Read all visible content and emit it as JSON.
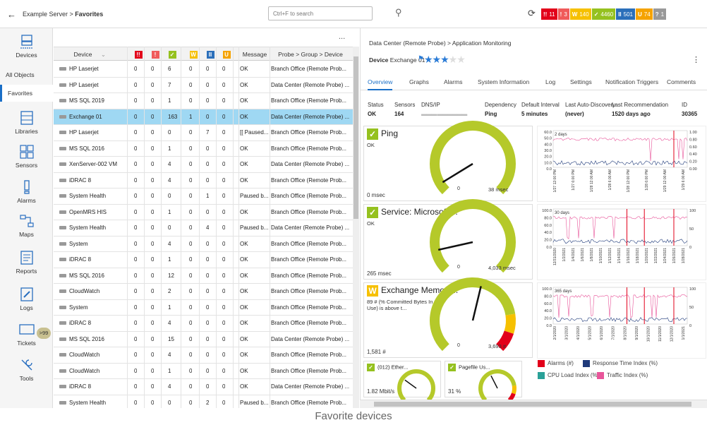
{
  "topbar": {
    "breadcrumb_prefix": "Example Server >",
    "breadcrumb_current": "Favorites",
    "search_placeholder": "Ctrl+F to search",
    "badges": [
      {
        "icon": "!!",
        "count": "11",
        "color": "#e2001a"
      },
      {
        "icon": "!",
        "count": "3",
        "color": "#f05a5a"
      },
      {
        "icon": "W",
        "count": "140",
        "color": "#f6c000"
      },
      {
        "icon": "✓",
        "count": "4460",
        "color": "#95c11f"
      },
      {
        "icon": "II",
        "count": "501",
        "color": "#2b6fba"
      },
      {
        "icon": "U",
        "count": "74",
        "color": "#f5a300"
      },
      {
        "icon": "?",
        "count": "1",
        "color": "#999999"
      }
    ]
  },
  "sidebar": {
    "items": [
      {
        "label": "Devices"
      },
      {
        "label": "All Objects"
      },
      {
        "label": "Favorites"
      },
      {
        "label": "Libraries"
      },
      {
        "label": "Sensors"
      },
      {
        "label": "Alarms"
      },
      {
        "label": "Maps"
      },
      {
        "label": "Reports"
      },
      {
        "label": "Logs"
      },
      {
        "label": "Tickets",
        "badge": ">99"
      },
      {
        "label": "Tools"
      }
    ]
  },
  "table": {
    "more_label": "...",
    "headers": {
      "device": "Device",
      "message": "Message",
      "path": "Probe > Group > Device",
      "status_icons": [
        "!!",
        "!",
        "✓",
        "W",
        "II",
        "U"
      ]
    },
    "rows": [
      {
        "device": "HP Laserjet",
        "c": [
          "0",
          "0",
          "6",
          "0",
          "0",
          "0"
        ],
        "message": "OK",
        "path": "Branch Office (Remote Prob..."
      },
      {
        "device": "HP Laserjet",
        "c": [
          "0",
          "0",
          "7",
          "0",
          "0",
          "0"
        ],
        "message": "OK",
        "path": "Data Center (Remote Probe) ..."
      },
      {
        "device": "MS SQL 2019",
        "c": [
          "0",
          "0",
          "1",
          "0",
          "0",
          "0"
        ],
        "message": "OK",
        "path": "Branch Office (Remote Prob..."
      },
      {
        "device": "Exchange 01",
        "c": [
          "0",
          "0",
          "163",
          "1",
          "0",
          "0"
        ],
        "message": "OK",
        "path": "Data Center (Remote Probe) ...",
        "selected": true
      },
      {
        "device": "HP Laserjet",
        "c": [
          "0",
          "0",
          "0",
          "0",
          "7",
          "0"
        ],
        "message": "[[ Paused...",
        "path": "Branch Office (Remote Prob..."
      },
      {
        "device": "MS SQL 2016",
        "c": [
          "0",
          "0",
          "1",
          "0",
          "0",
          "0"
        ],
        "message": "OK",
        "path": "Branch Office (Remote Prob..."
      },
      {
        "device": "XenServer-002 VM",
        "c": [
          "0",
          "0",
          "4",
          "0",
          "0",
          "0"
        ],
        "message": "OK",
        "path": "Data Center (Remote Probe) ..."
      },
      {
        "device": "iDRAC 8",
        "c": [
          "0",
          "0",
          "4",
          "0",
          "0",
          "0"
        ],
        "message": "OK",
        "path": "Branch Office (Remote Prob..."
      },
      {
        "device": "System Health",
        "c": [
          "0",
          "0",
          "0",
          "0",
          "1",
          "0"
        ],
        "message": "Paused b...",
        "path": "Branch Office (Remote Prob..."
      },
      {
        "device": "OpenMRS HIS",
        "c": [
          "0",
          "0",
          "1",
          "0",
          "0",
          "0"
        ],
        "message": "OK",
        "path": "Branch Office (Remote Prob..."
      },
      {
        "device": "System Health",
        "c": [
          "0",
          "0",
          "0",
          "0",
          "4",
          "0"
        ],
        "message": "Paused b...",
        "path": "Data Center (Remote Probe) ..."
      },
      {
        "device": "System",
        "c": [
          "0",
          "0",
          "4",
          "0",
          "0",
          "0"
        ],
        "message": "OK",
        "path": "Branch Office (Remote Prob..."
      },
      {
        "device": "iDRAC 8",
        "c": [
          "0",
          "0",
          "1",
          "0",
          "0",
          "0"
        ],
        "message": "OK",
        "path": "Branch Office (Remote Prob..."
      },
      {
        "device": "MS SQL 2016",
        "c": [
          "0",
          "0",
          "12",
          "0",
          "0",
          "0"
        ],
        "message": "OK",
        "path": "Branch Office (Remote Prob..."
      },
      {
        "device": "CloudWatch",
        "c": [
          "0",
          "0",
          "2",
          "0",
          "0",
          "0"
        ],
        "message": "OK",
        "path": "Branch Office (Remote Prob..."
      },
      {
        "device": "System",
        "c": [
          "0",
          "0",
          "1",
          "0",
          "0",
          "0"
        ],
        "message": "OK",
        "path": "Branch Office (Remote Prob..."
      },
      {
        "device": "iDRAC 8",
        "c": [
          "0",
          "0",
          "4",
          "0",
          "0",
          "0"
        ],
        "message": "OK",
        "path": "Branch Office (Remote Prob..."
      },
      {
        "device": "MS SQL 2016",
        "c": [
          "0",
          "0",
          "15",
          "0",
          "0",
          "0"
        ],
        "message": "OK",
        "path": "Data Center (Remote Probe) ..."
      },
      {
        "device": "CloudWatch",
        "c": [
          "0",
          "0",
          "4",
          "0",
          "0",
          "0"
        ],
        "message": "OK",
        "path": "Branch Office (Remote Prob..."
      },
      {
        "device": "CloudWatch",
        "c": [
          "0",
          "0",
          "1",
          "0",
          "0",
          "0"
        ],
        "message": "OK",
        "path": "Branch Office (Remote Prob..."
      },
      {
        "device": "iDRAC 8",
        "c": [
          "0",
          "0",
          "4",
          "0",
          "0",
          "0"
        ],
        "message": "OK",
        "path": "Data Center (Remote Probe) ..."
      },
      {
        "device": "System Health",
        "c": [
          "0",
          "0",
          "0",
          "0",
          "2",
          "0"
        ],
        "message": "Paused b...",
        "path": "Branch Office (Remote Prob..."
      }
    ]
  },
  "detail": {
    "path": "Data Center (Remote Probe) > Application Monitoring",
    "device_label": "Device",
    "device_name": "Exchange 01",
    "priority_stars": 3,
    "tabs": [
      "Overview",
      "Graphs",
      "Alarms",
      "System Information",
      "Log",
      "Settings",
      "Notification Triggers",
      "Comments"
    ],
    "active_tab": "Overview",
    "stats": {
      "headers": [
        "Status",
        "Sensors",
        "DNS/IP",
        "Dependency",
        "Default Interval",
        "Last Auto-Discovery",
        "Last Recommendation",
        "ID"
      ],
      "values": [
        "OK",
        "164",
        "",
        "Ping",
        "5 minutes",
        "(never)",
        "1520 days ago",
        "30365"
      ]
    },
    "gauges": [
      {
        "title": "Ping",
        "status_icon": "✓",
        "status_color": "#95c11f",
        "subtitle": "OK",
        "value": "0 msec",
        "min": "0",
        "max": "38 msec"
      },
      {
        "title": "Service: Microsoft ...",
        "status_icon": "✓",
        "status_color": "#95c11f",
        "subtitle": "OK",
        "value": "265 msec",
        "min": "0",
        "max": "4,033 msec"
      },
      {
        "title": "Exchange Memory...",
        "status_icon": "W",
        "status_color": "#f6c000",
        "subtitle": "89 # (% Committed Bytes In Use) is above t...",
        "value": "1,581 #",
        "min": "0",
        "max": "3,693 #"
      },
      {
        "title": "(012) Ether...",
        "status_icon": "✓",
        "status_color": "#95c11f",
        "subtitle": "",
        "value": "1.82 Mbit/s"
      },
      {
        "title": "Pagefile Us...",
        "status_icon": "✓",
        "status_color": "#95c11f",
        "subtitle": "",
        "value": "31 %"
      }
    ],
    "graphs": [
      {
        "period": "2 days",
        "ticks_left": [
          "60.0",
          "50.0",
          "40.0",
          "30.0",
          "20.0",
          "10.0",
          "0.0"
        ],
        "ticks_right": [
          "1.00",
          "0.80",
          "0.60",
          "0.40",
          "0.20",
          "0.00"
        ],
        "xlabels": [
          "1/27 12:00 PM",
          "1/27 6:00 PM",
          "1/28 12:00 AM",
          "1/28 6:00 AM",
          "1/28 12:00 PM",
          "1/28 6:00 PM",
          "1/29 12:00 AM",
          "1/29 6:00 AM"
        ]
      },
      {
        "period": "30 days",
        "ticks_left": [
          "100.0",
          "80.0",
          "60.0",
          "40.0",
          "20.0",
          "0.0"
        ],
        "ticks_right": [
          "100",
          "50",
          "0"
        ],
        "xlabels": [
          "12/31/2020",
          "1/2/2021",
          "1/4/2021",
          "1/6/2021",
          "1/8/2021",
          "1/10/2021",
          "1/12/2021",
          "1/14/2021",
          "1/16/2021",
          "1/18/2021",
          "1/20/2021",
          "1/22/2021",
          "1/24/2021",
          "1/26/2021",
          "1/28/2021"
        ]
      },
      {
        "period": "365 days",
        "ticks_left": [
          "100.0",
          "80.0",
          "60.0",
          "40.0",
          "20.0",
          "0.0"
        ],
        "ticks_right": [
          "100",
          "50",
          "0"
        ],
        "xlabels": [
          "2/1/2020",
          "3/1/2020",
          "4/1/2020",
          "5/1/2020",
          "6/1/2020",
          "7/1/2020",
          "8/1/2020",
          "9/1/2020",
          "10/1/2020",
          "11/1/2020",
          "12/1/2020",
          "1/1/2021"
        ]
      }
    ],
    "legend": [
      {
        "label": "Alarms  (#)",
        "color": "#e2001a"
      },
      {
        "label": "Response Time Index  (%)",
        "color": "#1f3a7a"
      },
      {
        "label": "CPU Load Index  (%)",
        "color": "#2aa198"
      },
      {
        "label": "Traffic Index  (%)",
        "color": "#e8559a"
      }
    ]
  },
  "caption": "Favorite devices",
  "colors": {
    "accent": "#1a6fc7",
    "gauge_green": "#b5c92a",
    "selected_row": "#9fd8f3"
  }
}
